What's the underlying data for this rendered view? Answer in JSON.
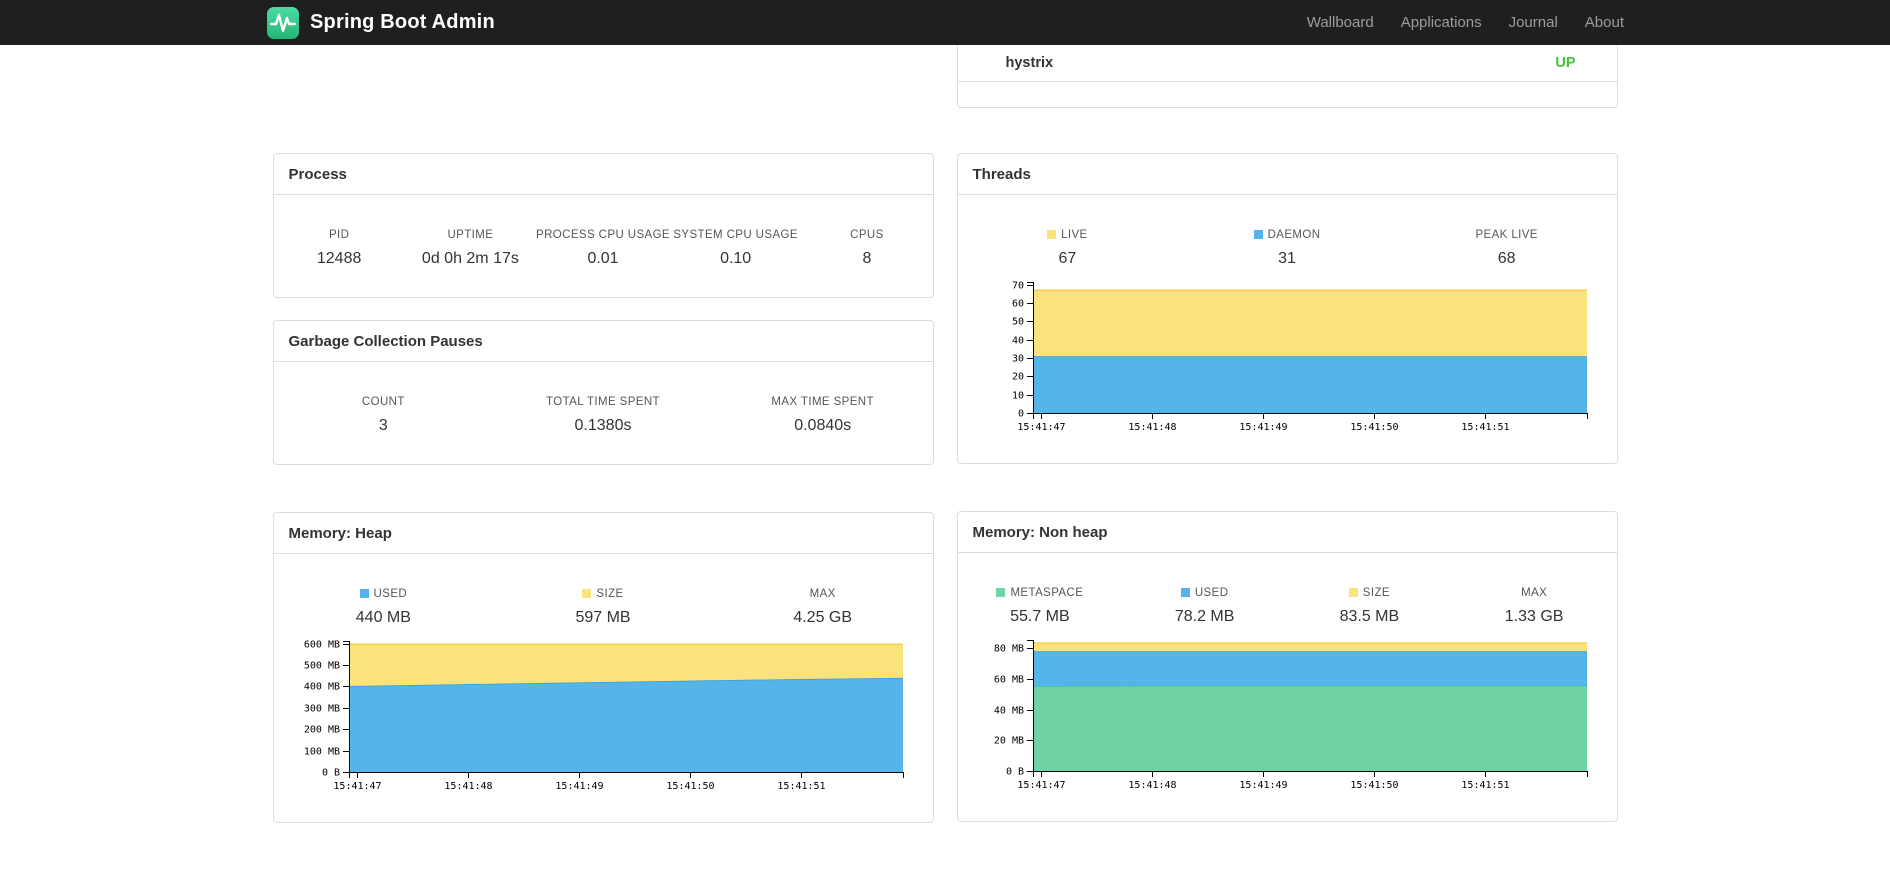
{
  "colors": {
    "blue": "#55b5e8",
    "blue_line": "#2b9fe0",
    "yellow": "#fce27d",
    "yellow_line": "#f4cf4a",
    "green": "#6fd3a6",
    "green_line": "#43c28f",
    "status_up": "#43c33e"
  },
  "navbar": {
    "brand": "Spring Boot Admin",
    "links": [
      {
        "label": "Wallboard"
      },
      {
        "label": "Applications"
      },
      {
        "label": "Journal"
      },
      {
        "label": "About"
      }
    ]
  },
  "application_row": {
    "name": "hystrix",
    "status": "UP",
    "status_color": "#43c33e"
  },
  "process": {
    "title": "Process",
    "stats": [
      {
        "label": "PID",
        "value": "12488"
      },
      {
        "label": "UPTIME",
        "value": "0d 0h 2m 17s"
      },
      {
        "label": "PROCESS CPU USAGE",
        "value": "0.01"
      },
      {
        "label": "SYSTEM CPU USAGE",
        "value": "0.10"
      },
      {
        "label": "CPUS",
        "value": "8"
      }
    ]
  },
  "gc": {
    "title": "Garbage Collection Pauses",
    "stats": [
      {
        "label": "COUNT",
        "value": "3"
      },
      {
        "label": "TOTAL TIME SPENT",
        "value": "0.1380s"
      },
      {
        "label": "MAX TIME SPENT",
        "value": "0.0840s"
      }
    ]
  },
  "threads": {
    "title": "Threads",
    "stats": [
      {
        "label": "LIVE",
        "value": "67",
        "color": "#fce27d"
      },
      {
        "label": "DAEMON",
        "value": "31",
        "color": "#55b5e8"
      },
      {
        "label": "PEAK LIVE",
        "value": "68"
      }
    ]
  },
  "heap": {
    "title": "Memory: Heap",
    "stats": [
      {
        "label": "USED",
        "value": "440 MB",
        "color": "#55b5e8"
      },
      {
        "label": "SIZE",
        "value": "597 MB",
        "color": "#fce27d"
      },
      {
        "label": "MAX",
        "value": "4.25 GB"
      }
    ]
  },
  "nonheap": {
    "title": "Memory: Non heap",
    "stats": [
      {
        "label": "METASPACE",
        "value": "55.7 MB",
        "color": "#6fd3a6"
      },
      {
        "label": "USED",
        "value": "78.2 MB",
        "color": "#55b5e8"
      },
      {
        "label": "SIZE",
        "value": "83.5 MB",
        "color": "#fce27d"
      },
      {
        "label": "MAX",
        "value": "1.33 GB"
      }
    ]
  },
  "chart_data": [
    {
      "id": "threads",
      "type": "area",
      "title": "Threads",
      "stacking": "cumulative-top",
      "x_labels": [
        "15:41:47",
        "15:41:48",
        "15:41:49",
        "15:41:50",
        "15:41:51"
      ],
      "ylim": [
        0,
        71.5
      ],
      "yticks": [
        {
          "v": 0,
          "label": "0"
        },
        {
          "v": 10,
          "label": "10"
        },
        {
          "v": 20,
          "label": "20"
        },
        {
          "v": 30,
          "label": "30"
        },
        {
          "v": 40,
          "label": "40"
        },
        {
          "v": 50,
          "label": "50"
        },
        {
          "v": 60,
          "label": "60"
        },
        {
          "v": 70,
          "label": "70"
        }
      ],
      "stacked_layers": [
        {
          "name": "DAEMON",
          "fill": "#55b5e8",
          "line": "#2b9fe0",
          "top_values": [
            31,
            31,
            31,
            31,
            31,
            31
          ]
        },
        {
          "name": "LIVE",
          "fill": "#fce27d",
          "line": "#f4cf4a",
          "top_values": [
            67,
            67,
            67,
            67,
            67,
            67
          ]
        }
      ]
    },
    {
      "id": "heap",
      "type": "area",
      "title": "Memory: Heap",
      "stacking": "cumulative-top",
      "x_labels": [
        "15:41:47",
        "15:41:48",
        "15:41:49",
        "15:41:50",
        "15:41:51"
      ],
      "ylim": [
        0,
        612
      ],
      "yticks": [
        {
          "v": 0,
          "label": "0 B"
        },
        {
          "v": 100,
          "label": "100 MB"
        },
        {
          "v": 200,
          "label": "200 MB"
        },
        {
          "v": 300,
          "label": "300 MB"
        },
        {
          "v": 400,
          "label": "400 MB"
        },
        {
          "v": 500,
          "label": "500 MB"
        },
        {
          "v": 600,
          "label": "600 MB"
        }
      ],
      "stacked_layers": [
        {
          "name": "USED",
          "fill": "#55b5e8",
          "line": "#2b9fe0",
          "top_values": [
            402,
            410,
            418,
            426,
            434,
            440
          ]
        },
        {
          "name": "SIZE",
          "fill": "#fce27d",
          "line": "#f4cf4a",
          "top_values": [
            597,
            597,
            597,
            597,
            597,
            597
          ]
        }
      ]
    },
    {
      "id": "nonheap",
      "type": "area",
      "title": "Memory: Non heap",
      "stacking": "cumulative-top",
      "x_labels": [
        "15:41:47",
        "15:41:48",
        "15:41:49",
        "15:41:50",
        "15:41:51"
      ],
      "ylim": [
        0,
        85.5
      ],
      "yticks": [
        {
          "v": 0,
          "label": "0 B"
        },
        {
          "v": 20,
          "label": "20 MB"
        },
        {
          "v": 40,
          "label": "40 MB"
        },
        {
          "v": 60,
          "label": "60 MB"
        },
        {
          "v": 80,
          "label": "80 MB"
        }
      ],
      "stacked_layers": [
        {
          "name": "METASPACE",
          "fill": "#6fd3a6",
          "line": "#43c28f",
          "top_values": [
            55.5,
            55.6,
            55.6,
            55.7,
            55.7,
            55.7
          ]
        },
        {
          "name": "USED",
          "fill": "#55b5e8",
          "line": "#2b9fe0",
          "top_values": [
            78.2,
            78.2,
            78.2,
            78.2,
            78.2,
            78.2
          ]
        },
        {
          "name": "SIZE",
          "fill": "#fce27d",
          "line": "#f4cf4a",
          "top_values": [
            83.5,
            83.5,
            83.5,
            83.5,
            83.5,
            83.5
          ]
        }
      ]
    }
  ]
}
